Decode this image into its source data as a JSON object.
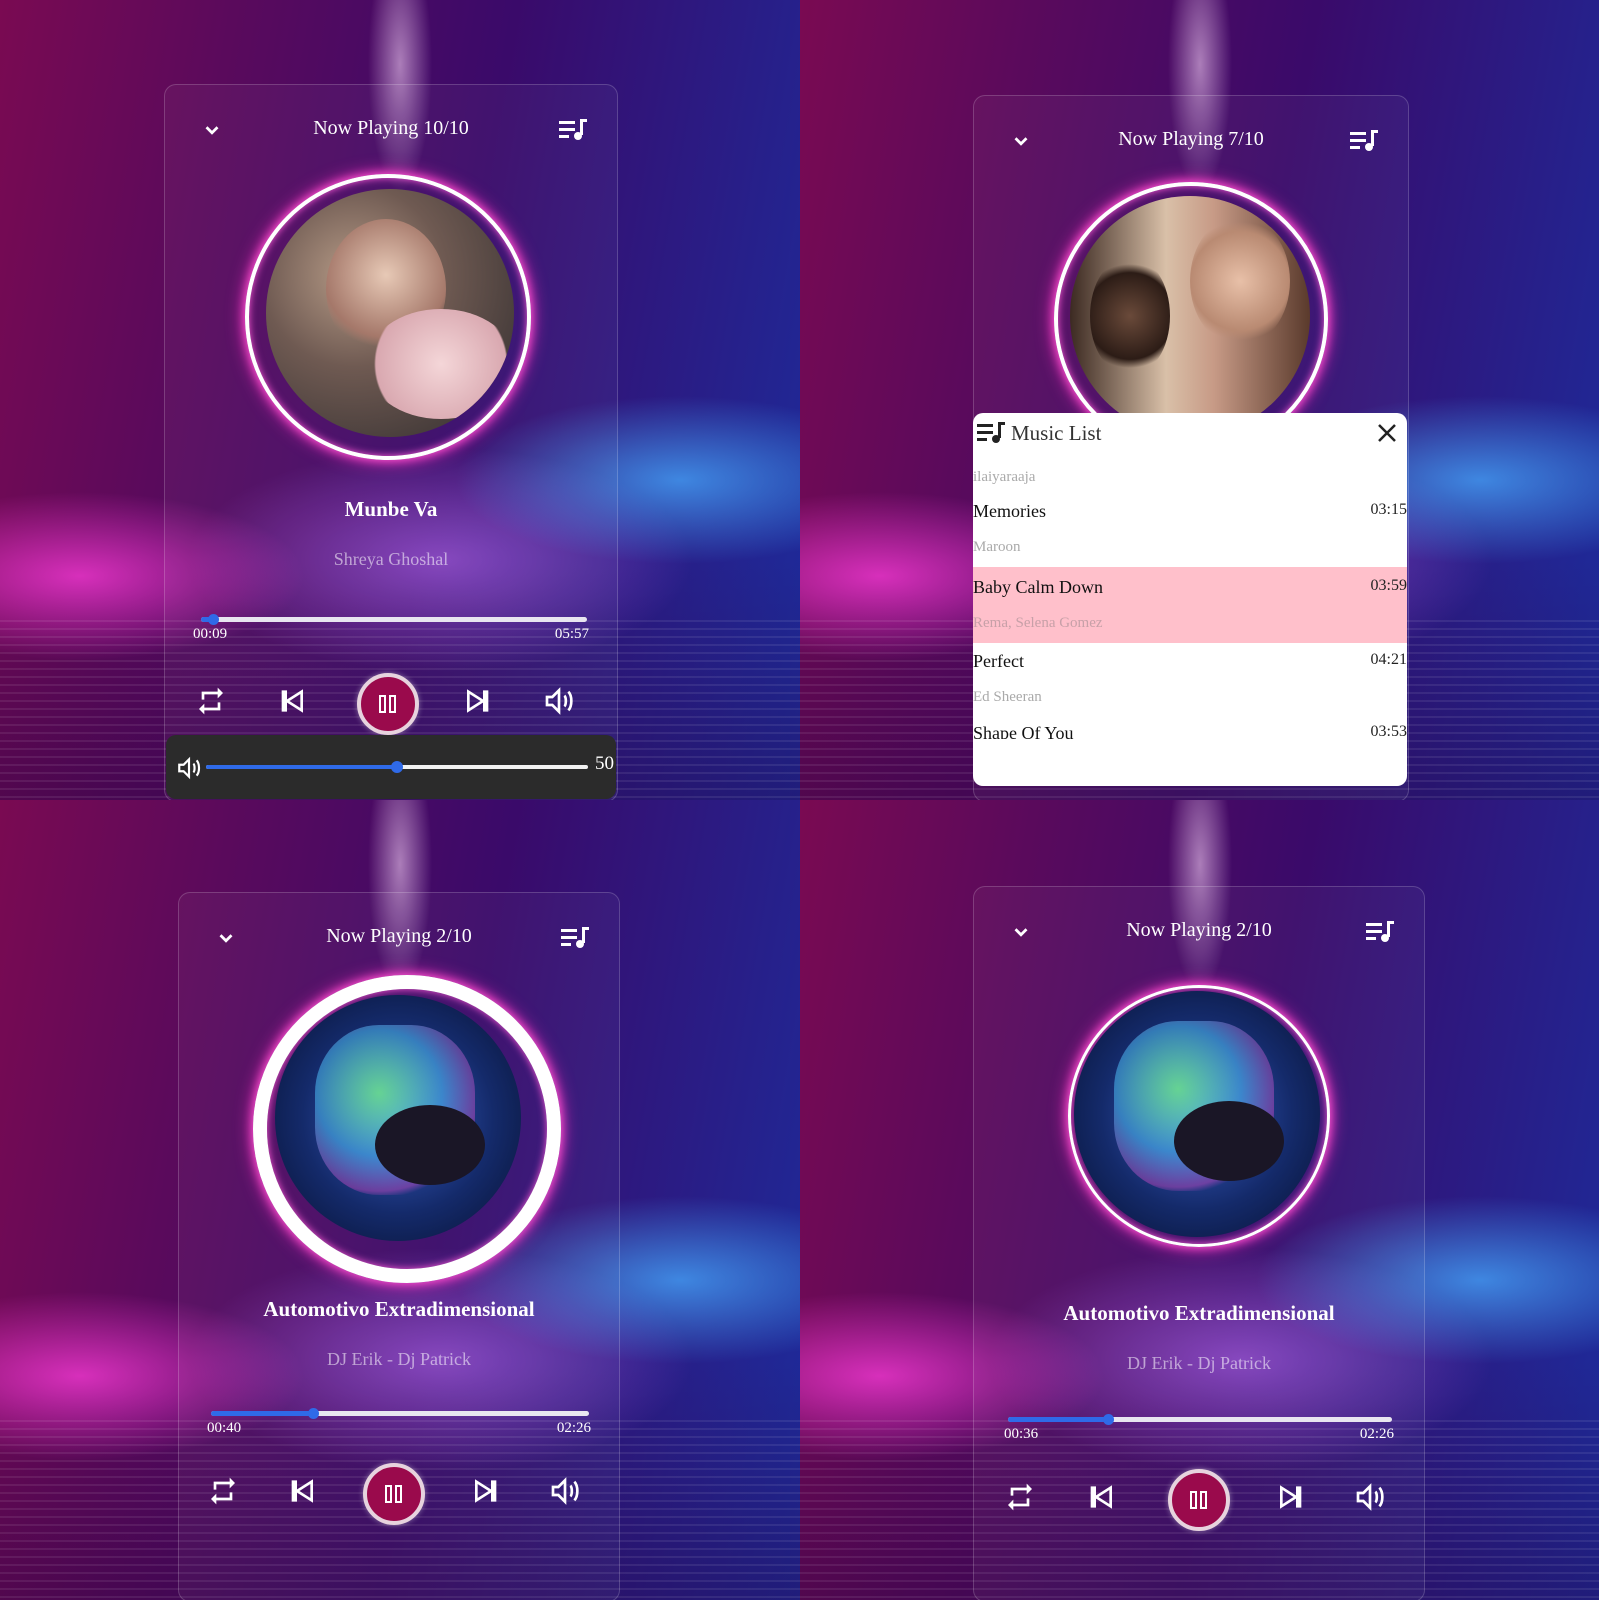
{
  "panels": [
    {
      "now_playing": "Now Playing 10/10",
      "song": "Munbe Va",
      "artist": "Shreya Ghoshal",
      "current_time": "00:09",
      "total_time": "05:57",
      "progress": 0.03
    },
    {
      "now_playing": "Now Playing 7/10",
      "music_list": {
        "title": "Music List",
        "first_artist": "ilaiyaraaja",
        "items": [
          {
            "name": "Memories",
            "artist": "Maroon",
            "duration": "03:15"
          },
          {
            "name": "Baby Calm Down",
            "artist": "Rema, Selena Gomez",
            "duration": "03:59",
            "active": true
          },
          {
            "name": "Perfect",
            "artist": "Ed Sheeran",
            "duration": "04:21"
          },
          {
            "name": "Shape Of You",
            "artist": "",
            "duration": "03:53"
          }
        ]
      }
    },
    {
      "now_playing": "Now Playing 2/10",
      "song": "Automotivo Extradimensional",
      "artist": "DJ Erik - Dj Patrick",
      "current_time": "00:40",
      "total_time": "02:26",
      "progress": 0.27
    },
    {
      "now_playing": "Now Playing 2/10",
      "song": "Automotivo Extradimensional",
      "artist": "DJ Erik - Dj Patrick",
      "current_time": "00:36",
      "total_time": "02:26",
      "progress": 0.26
    }
  ],
  "volume": {
    "value": "50",
    "level": 0.5
  },
  "colors": {
    "accent": "#2f6ae8",
    "play_button": "#9a0a4c",
    "active_row": "#ffc0cb",
    "ring_glow": "#ff2fbf"
  },
  "icons": [
    "chevron-down-icon",
    "queue-music-icon",
    "repeat-icon",
    "skip-previous-icon",
    "pause-icon",
    "skip-next-icon",
    "volume-icon",
    "close-icon"
  ]
}
